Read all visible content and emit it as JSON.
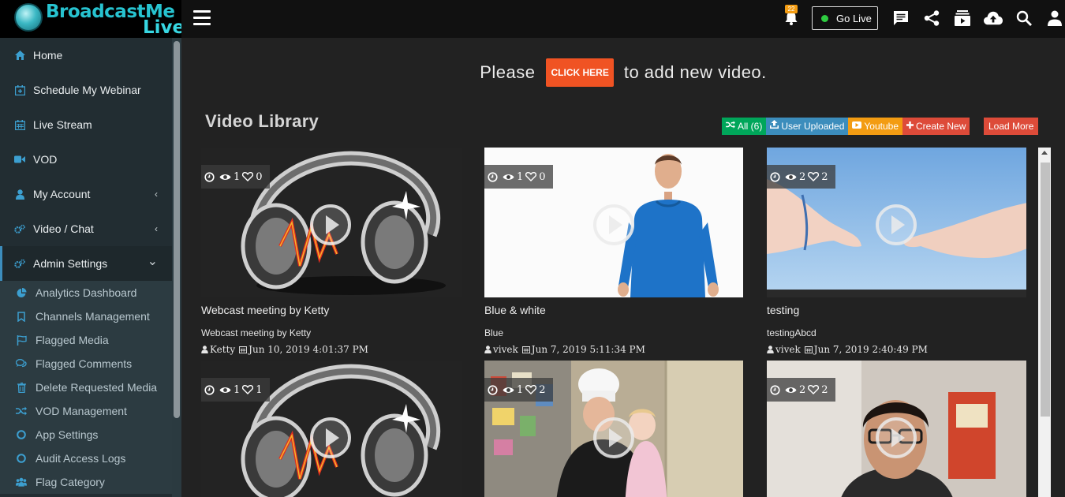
{
  "brand": {
    "line1": "BroadcastMe",
    "line2": "Live"
  },
  "sidebar": {
    "items": [
      {
        "label": "Home",
        "icon": "home-icon"
      },
      {
        "label": "Schedule My Webinar",
        "icon": "calendar-plus-icon"
      },
      {
        "label": "Live Stream",
        "icon": "calendar-icon"
      },
      {
        "label": "VOD",
        "icon": "video-camera-icon"
      },
      {
        "label": "My Account",
        "icon": "user-icon",
        "chevron": "‹"
      },
      {
        "label": "Video / Chat",
        "icon": "gears-icon",
        "chevron": "‹"
      },
      {
        "label": "Admin Settings",
        "icon": "gears-icon",
        "chevron": "⌄"
      }
    ],
    "submenu": [
      {
        "label": "Analytics Dashboard",
        "icon": "pie-chart-icon"
      },
      {
        "label": "Channels Management",
        "icon": "bookmark-icon"
      },
      {
        "label": "Flagged Media",
        "icon": "flag-icon"
      },
      {
        "label": "Flagged Comments",
        "icon": "comments-icon"
      },
      {
        "label": "Delete Requested Media",
        "icon": "trash-icon"
      },
      {
        "label": "VOD Management",
        "icon": "random-icon"
      },
      {
        "label": "App Settings",
        "icon": "circle-icon"
      },
      {
        "label": "Audit Access Logs",
        "icon": "circle-icon"
      },
      {
        "label": "Flag Category",
        "icon": "users-icon"
      }
    ]
  },
  "topbar": {
    "notification_count": "22",
    "go_live_label": "Go Live",
    "icons": [
      "bell-icon",
      "chat-icon",
      "share-icon",
      "playlist-icon",
      "cloud-upload-icon",
      "search-icon",
      "user-icon"
    ]
  },
  "cta": {
    "prefix": "Please",
    "button": "CLICK HERE",
    "suffix": "to add new video."
  },
  "library": {
    "title": "Video Library",
    "filters": [
      {
        "label": "All (6)",
        "icon": "random-icon"
      },
      {
        "label": "User Uploaded",
        "icon": "upload-icon"
      },
      {
        "label": "Youtube",
        "icon": "youtube-icon"
      },
      {
        "label": "Create New",
        "icon": "plus-icon"
      }
    ],
    "load_more": "Load More",
    "videos": [
      {
        "thumb": "headphones",
        "likes_prefix": "1",
        "views": "1",
        "likes": "0",
        "title": "Webcast meeting by Ketty",
        "desc": "Webcast meeting by Ketty",
        "user": "Ketty",
        "date": "Jun 10, 2019 4:01:37 PM"
      },
      {
        "thumb": "man-blue",
        "views": "1",
        "likes": "0",
        "title": "Blue & white",
        "desc": "Blue",
        "user": "vivek",
        "date": "Jun 7, 2019 5:11:34 PM"
      },
      {
        "thumb": "hands",
        "views": "2",
        "likes": "2",
        "title": "testing",
        "desc": "testingAbcd",
        "user": "vivek",
        "date": "Jun 7, 2019 2:40:49 PM"
      },
      {
        "thumb": "headphones",
        "views": "1",
        "likes": "1",
        "title": "",
        "desc": "",
        "user": "",
        "date": ""
      },
      {
        "thumb": "kitchen",
        "views": "1",
        "likes": "2",
        "title": "",
        "desc": "",
        "user": "",
        "date": ""
      },
      {
        "thumb": "man-glasses",
        "views": "2",
        "likes": "2",
        "title": "",
        "desc": "",
        "user": "",
        "date": ""
      }
    ]
  },
  "colors": {
    "accent": "#3c8dbc",
    "cta": "#f05323",
    "green": "#00a65a",
    "orange": "#f39c12",
    "red": "#dd4b39"
  }
}
